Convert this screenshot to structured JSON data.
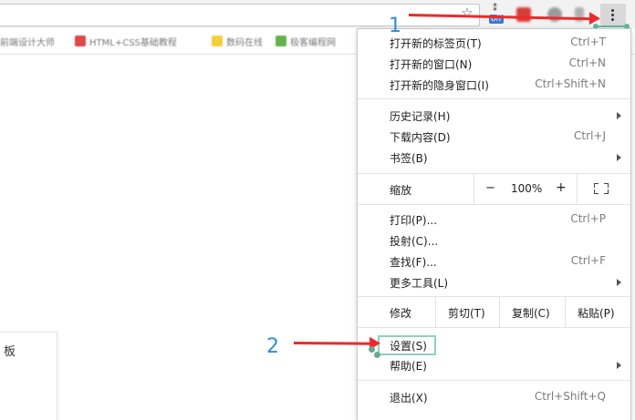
{
  "toolbar": {
    "extension_badge": "off",
    "icons": [
      "star-icon",
      "extension-off-icon",
      "extension-red-icon",
      "extension-gray-icon",
      "more-vert-icon"
    ]
  },
  "bookmarks": [
    {
      "label": "前端设计大师",
      "color": "#e8a23a"
    },
    {
      "label": "HTML+CSS基础教程",
      "color": "#e04848"
    },
    {
      "label": "数码在线",
      "color": "#f3cf3b"
    },
    {
      "label": "极客编程网",
      "color": "#66b34e"
    }
  ],
  "side_panel": {
    "text": "板"
  },
  "annotations": {
    "step1": "1",
    "step2": "2"
  },
  "menu": {
    "new_tab": {
      "label": "打开新的标签页(T)",
      "shortcut": "Ctrl+T"
    },
    "new_window": {
      "label": "打开新的窗口(N)",
      "shortcut": "Ctrl+N"
    },
    "incognito": {
      "label": "打开新的隐身窗口(I)",
      "shortcut": "Ctrl+Shift+N"
    },
    "history": {
      "label": "历史记录(H)"
    },
    "downloads": {
      "label": "下载内容(D)",
      "shortcut": "Ctrl+J"
    },
    "bookmarks": {
      "label": "书签(B)"
    },
    "zoom": {
      "label": "缩放",
      "minus": "−",
      "value": "100%",
      "plus": "+"
    },
    "print": {
      "label": "打印(P)...",
      "shortcut": "Ctrl+P"
    },
    "cast": {
      "label": "投射(C)..."
    },
    "find": {
      "label": "查找(F)...",
      "shortcut": "Ctrl+F"
    },
    "more_tools": {
      "label": "更多工具(L)"
    },
    "edit": {
      "label": "修改",
      "cut": "剪切(T)",
      "copy": "复制(C)",
      "paste": "粘贴(P)"
    },
    "settings": {
      "label": "设置(S)"
    },
    "help": {
      "label": "帮助(E)"
    },
    "exit": {
      "label": "退出(X)",
      "shortcut": "Ctrl+Shift+Q"
    }
  }
}
